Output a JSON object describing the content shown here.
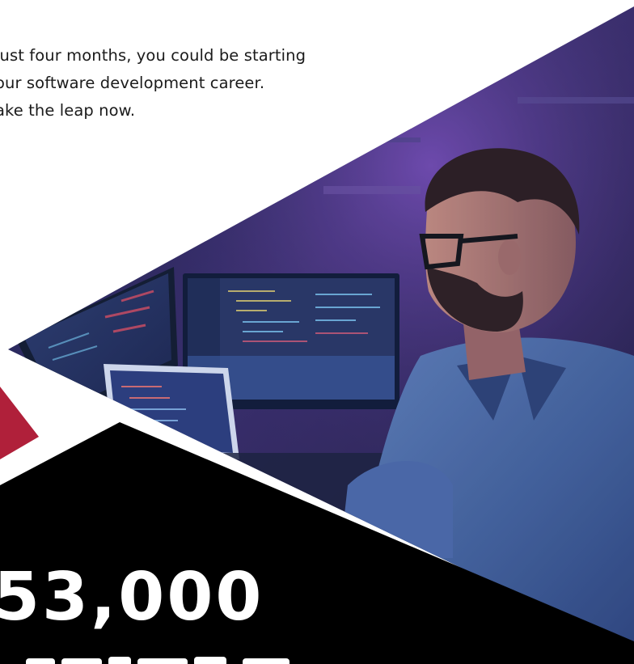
{
  "intro": {
    "lines": [
      "just four months, you could be starting",
      "our software development career.",
      "ake the leap now."
    ]
  },
  "stat": {
    "value": "53,000"
  },
  "colors": {
    "accent_red": "#b0203a",
    "black_panel": "#000000",
    "night_sky": "#2a2347",
    "screen_glow": "#6d8dd6"
  }
}
